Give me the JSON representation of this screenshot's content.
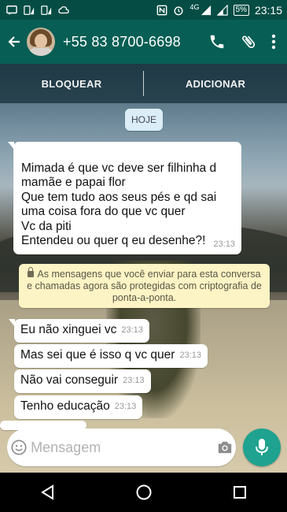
{
  "status_bar": {
    "battery": "5%",
    "time": "23:15",
    "network": "4G",
    "icons": [
      "sms-icon",
      "dual-sim-signal-icon",
      "dual-sim-signal-icon",
      "cloud-icon",
      "nfc-icon",
      "alarm-icon",
      "signal-icon",
      "signal-icon",
      "battery-icon"
    ]
  },
  "app_bar": {
    "contact": "+55 83 8700-6698",
    "actions": [
      "back-arrow-icon",
      "phone-icon",
      "paperclip-icon",
      "more-vert-icon"
    ]
  },
  "action_bar": {
    "block_label": "BLOQUEAR",
    "add_label": "ADICIONAR"
  },
  "chat": {
    "date_chip": "HOJE",
    "messages": [
      {
        "text": "Mimada é que vc deve ser filhinha d\nmamãe e papai flor\nQue tem tudo aos seus pés e qd sai\numa coisa fora do que vc quer\nVc da piti\nEntendeu ou quer q eu desenhe?!",
        "time": "23:13"
      },
      {
        "text": "Eu não xinguei vc",
        "time": "23:13"
      },
      {
        "text": "Mas sei que é isso q vc quer",
        "time": "23:13"
      },
      {
        "text": "Não vai conseguir",
        "time": "23:13"
      },
      {
        "text": "Tenho educação",
        "time": "23:13"
      }
    ],
    "encryption_notice": "As mensagens que você enviar para esta conversa e chamadas agora são protegidas com criptografia de ponta-a-ponta."
  },
  "composer": {
    "placeholder": "Mensagem"
  },
  "colors": {
    "header": "#075e54",
    "status_bar": "#054d44",
    "mic_button": "#1fa28f",
    "notice_bg": "#fdf4c5"
  }
}
